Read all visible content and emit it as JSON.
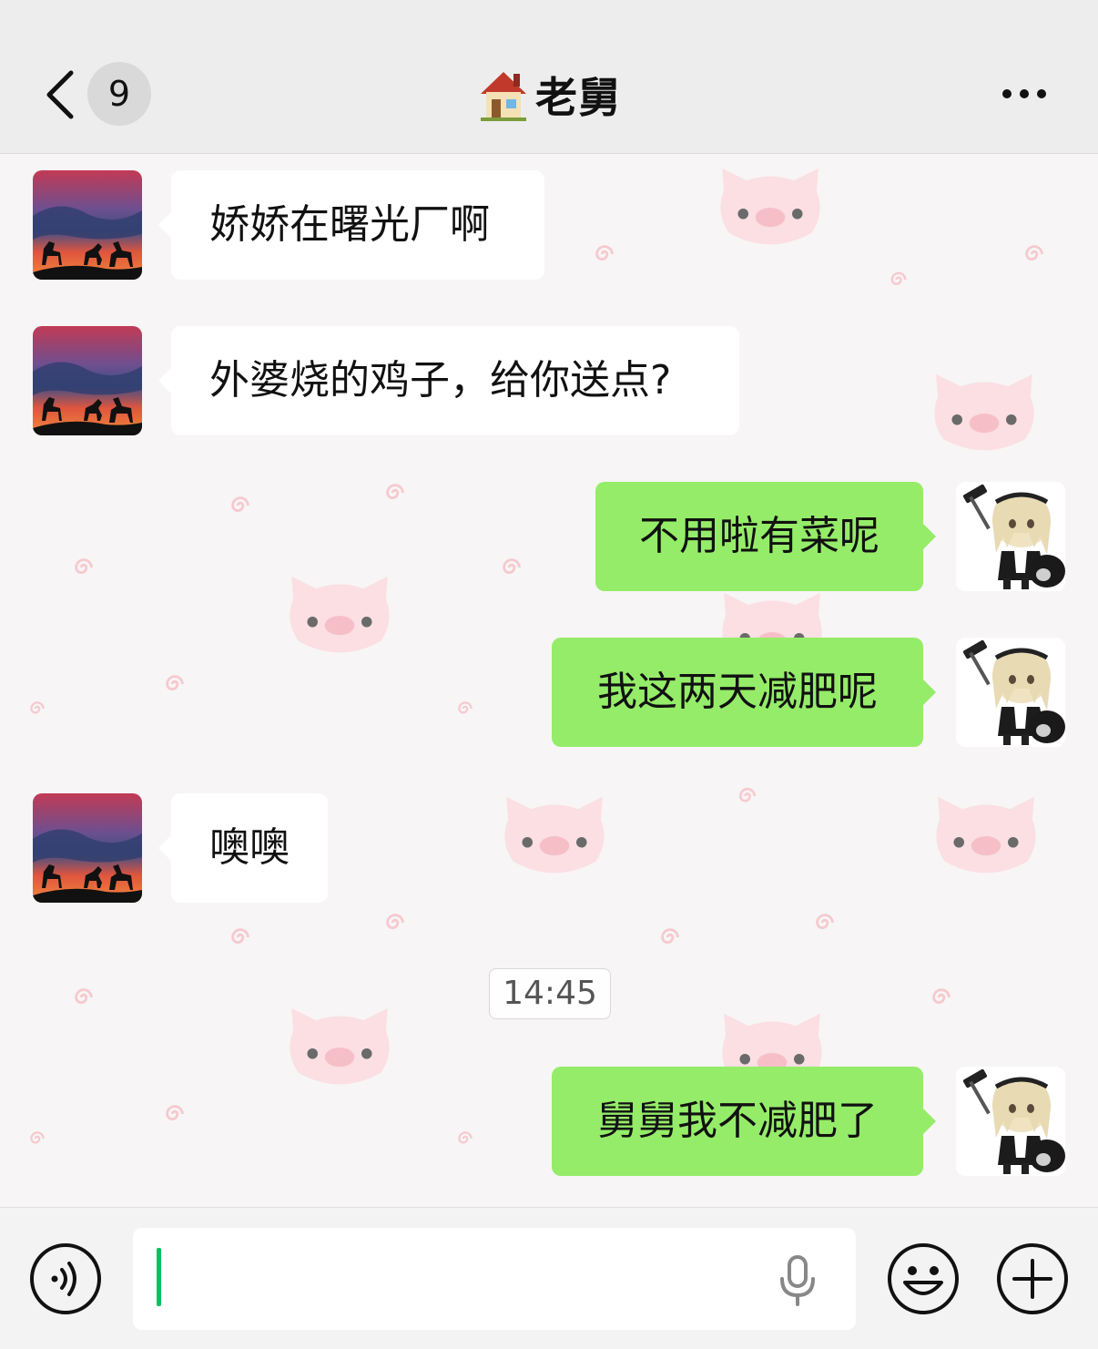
{
  "header": {
    "back_icon": "chevron-left-icon",
    "unread_count": "9",
    "title_emoji": "house-emoji-icon",
    "title": "老舅",
    "more_icon": "more-dots-icon"
  },
  "messages": [
    {
      "direction": "in",
      "text": "娇娇在曙光厂啊"
    },
    {
      "direction": "in",
      "text": "外婆烧的鸡子，给你送点?"
    },
    {
      "direction": "out",
      "text": "不用啦有菜呢"
    },
    {
      "direction": "out",
      "text": "我这两天减肥呢"
    },
    {
      "direction": "in",
      "text": "噢噢"
    },
    {
      "direction": "timestamp",
      "text": "14:45"
    },
    {
      "direction": "out",
      "text": "舅舅我不减肥了"
    }
  ],
  "colors": {
    "header_bg": "#ededed",
    "bubble_in": "#ffffff",
    "bubble_out": "#95ec69",
    "caret": "#07c160"
  },
  "input_bar": {
    "voice_icon": "voice-mode-icon",
    "input_value": "",
    "mic_icon": "microphone-icon",
    "emoji_icon": "emoji-smile-icon",
    "plus_icon": "plus-circle-icon"
  }
}
